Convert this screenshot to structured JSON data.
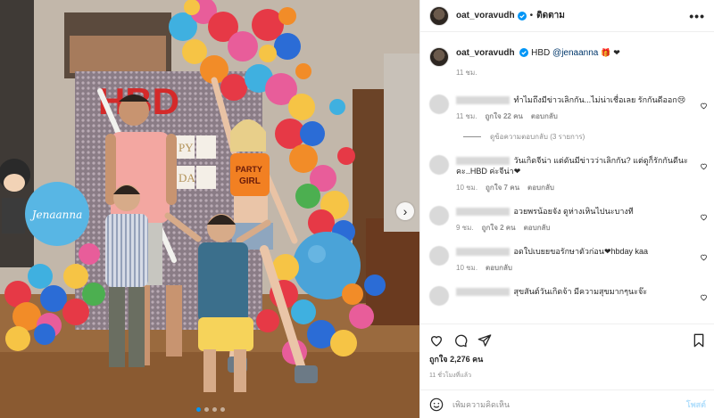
{
  "photo": {
    "balloon_sign": "HBD",
    "side_balloon_text": "Jenaanna",
    "shirt_text_line1": "PARTY",
    "shirt_text_line2": "GIRL",
    "banner_letters": [
      "PY",
      "DA"
    ],
    "dots_total": 4,
    "dots_active_index": 0,
    "balloon_colors": [
      "#e63946",
      "#f28c28",
      "#f6c445",
      "#2b6cd6",
      "#3fb0e0",
      "#e85d9a",
      "#4caf50",
      "#ffffff"
    ]
  },
  "header": {
    "username": "oat_voravudh",
    "separator": "•",
    "follow_label": "ติดตาม",
    "more_label": "•••"
  },
  "caption": {
    "username": "oat_voravudh",
    "text": "HBD",
    "mention": "@jenaanna",
    "emojis": "🎁 ❤",
    "time": "11 ชม."
  },
  "comments": [
    {
      "text": "ทำไมถึงมีข่าวเลิกกัน...ไม่น่าเชื่อเลย รักกันดีออก😢",
      "time": "11 ชม.",
      "likes": "ถูกใจ 22 คน",
      "reply_label": "ตอบกลับ",
      "view_replies": "ดูข้อความตอบกลับ (3 รายการ)"
    },
    {
      "text": "วันเกิดจีน่า แต่ดันมีข่าวว่าเลิกกัน? แต่ดูก็รักกันดีนะคะ..HBD ค่ะจีน่า❤",
      "time": "10 ชม.",
      "likes": "ถูกใจ 7 คน",
      "reply_label": "ตอบกลับ"
    },
    {
      "text": "อวยพรน้อยจัง ดูห่างเหินไปนะบางที",
      "time": "9 ชม.",
      "likes": "ถูกใจ 2 คน",
      "reply_label": "ตอบกลับ"
    },
    {
      "text": "อดใปเบยยขอรักษาตัวก่อน❤hbday kaa",
      "time": "10 ชม.",
      "reply_label": "ตอบกลับ"
    },
    {
      "text": "สุขสันต์วันเกิดจ้า มีความสุขมากๆนะจ๊ะ"
    }
  ],
  "actions": {
    "likes_text": "ถูกใจ 2,276 คน",
    "posted_time": "11 ชั่วโมงที่แล้ว"
  },
  "add_comment": {
    "placeholder": "เพิ่มความคิดเห็น",
    "post_label": "โพสต์"
  },
  "colors": {
    "link": "#00376b",
    "verified": "#0095f6",
    "heart": "#ed4956",
    "post_disabled": "#b2dffc",
    "muted": "#8e8e8e"
  }
}
